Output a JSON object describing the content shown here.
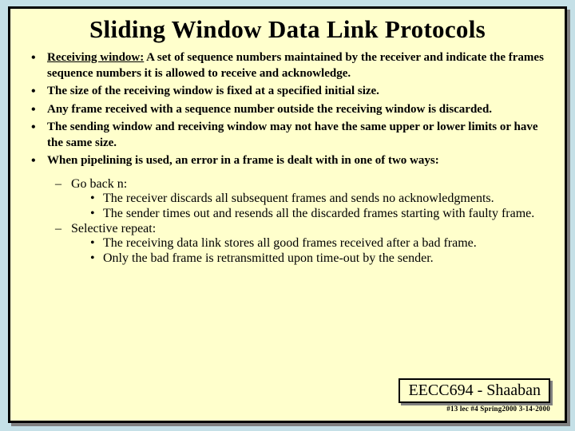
{
  "title": "Sliding Window Data Link Protocols",
  "bullets": [
    {
      "term": "Receiving window:",
      "text": "  A set of sequence numbers maintained by the receiver and indicate the frames sequence numbers it is allowed to receive and acknowledge."
    },
    {
      "text": "The size of the receiving window is fixed at a specified initial size."
    },
    {
      "text": "Any frame received with a sequence number outside the receiving window is discarded."
    },
    {
      "text": "The sending window and receiving window may not have the same upper or lower limits or have the same size."
    },
    {
      "text": "When pipelining is used, an error in a frame is dealt with in one of two ways:"
    }
  ],
  "methods": [
    {
      "name": "Go back n:",
      "points": [
        "The receiver discards all subsequent frames and sends no acknowledgments.",
        "The sender times out and resends all the discarded frames starting with faulty frame."
      ]
    },
    {
      "name": "Selective repeat:",
      "points": [
        "The receiving data link stores all good frames received after a bad frame.",
        "Only the bad frame is retransmitted upon time-out by the sender."
      ]
    }
  ],
  "footer": {
    "course": "EECC694 - Shaaban",
    "lec": "#13 lec #4  Spring2000  3-14-2000"
  }
}
